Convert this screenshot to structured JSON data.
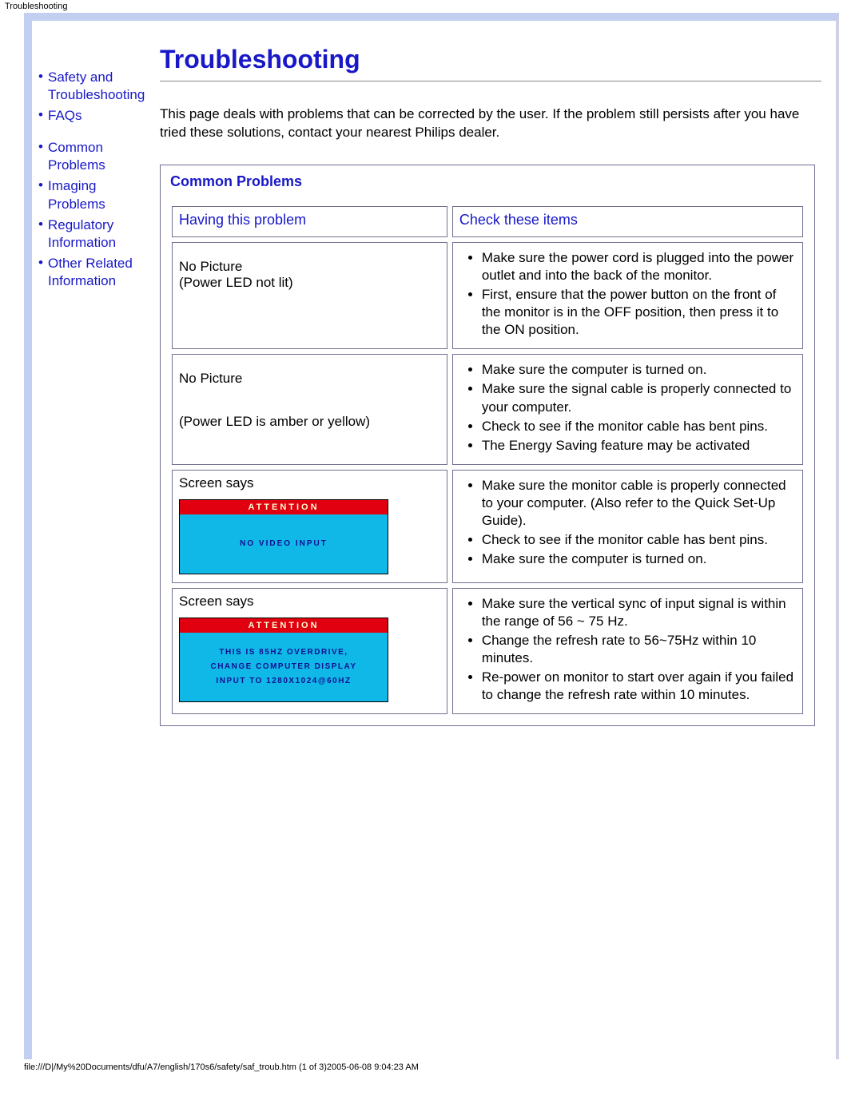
{
  "header": {
    "title": "Troubleshooting"
  },
  "sidebar": {
    "items": [
      {
        "label": "Safety and Troubleshooting"
      },
      {
        "label": "FAQs"
      },
      {
        "label": "Common Problems"
      },
      {
        "label": "Imaging Problems"
      },
      {
        "label": "Regulatory Information"
      },
      {
        "label": "Other Related Information"
      }
    ]
  },
  "main": {
    "title": "Troubleshooting",
    "intro": "This page deals with problems that can be corrected by the user. If the problem still persists after you have tried these solutions, contact your nearest Philips dealer.",
    "section_title": "Common Problems",
    "col1": "Having this problem",
    "col2": "Check these items",
    "rows": [
      {
        "problem_a": "No Picture",
        "problem_b": "(Power LED not lit)",
        "checks": [
          "Make sure the power cord is plugged into the power outlet and into the back of the monitor.",
          "First, ensure that the power button on the front of the monitor is in the OFF position, then press it to the ON position."
        ]
      },
      {
        "problem_a": "No Picture",
        "problem_b": "(Power LED is amber or yellow)",
        "checks": [
          "Make sure the computer is turned on.",
          "Make sure the signal cable is properly connected to your computer.",
          "Check to see if the monitor cable has bent pins.",
          "The Energy Saving feature may be activated"
        ]
      },
      {
        "problem_a": "Screen says",
        "osd": {
          "attention": "ATTENTION",
          "body": "NO VIDEO INPUT"
        },
        "checks": [
          "Make sure the monitor cable is properly connected to your computer. (Also refer to the Quick Set-Up Guide).",
          "Check to see if the monitor cable has bent pins.",
          "Make sure the computer is turned on."
        ]
      },
      {
        "problem_a": "Screen says",
        "osd": {
          "attention": "ATTENTION",
          "body_lines": [
            "THIS IS 85HZ OVERDRIVE,",
            "CHANGE COMPUTER DISPLAY",
            "INPUT TO 1280X1024@60HZ"
          ]
        },
        "checks": [
          "Make sure the vertical sync of input signal is within the range of 56 ~ 75 Hz.",
          "Change the refresh rate to 56~75Hz within 10 minutes.",
          "Re-power on monitor to start over again if you failed to change the refresh rate within 10 minutes."
        ]
      }
    ]
  },
  "footer": {
    "text": "file:///D|/My%20Documents/dfu/A7/english/170s6/safety/saf_troub.htm (1 of 3)2005-06-08 9:04:23 AM"
  }
}
